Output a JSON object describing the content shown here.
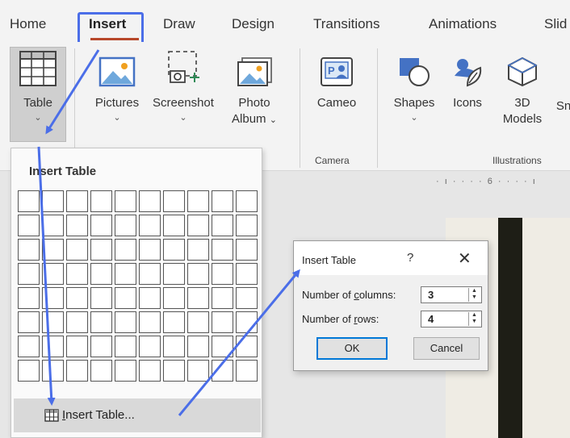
{
  "tabs": [
    {
      "label": "Home"
    },
    {
      "label": "Insert"
    },
    {
      "label": "Draw"
    },
    {
      "label": "Design"
    },
    {
      "label": "Transitions"
    },
    {
      "label": "Animations"
    },
    {
      "label": "Slid"
    }
  ],
  "ribbon": {
    "table": {
      "label": "Table",
      "icon": "table-icon"
    },
    "pictures": {
      "label": "Pictures",
      "icon": "pictures-icon"
    },
    "screenshot": {
      "label": "Screenshot",
      "icon": "screenshot-icon"
    },
    "photo_album": {
      "label1": "Photo",
      "label2": "Album",
      "icon": "photo-album-icon"
    },
    "cameo": {
      "label": "Cameo",
      "icon": "cameo-icon"
    },
    "shapes": {
      "label": "Shapes",
      "icon": "shapes-icon"
    },
    "icons": {
      "label": "Icons",
      "icon": "icons-icon"
    },
    "models": {
      "label1": "3D",
      "label2": "Models",
      "icon": "3d-models-icon"
    },
    "smartart": {
      "label": "Sn"
    },
    "group_camera": "Camera",
    "group_illustrations": "Illustrations"
  },
  "ruler": {
    "text": "· ı · · · · 6 · · · · ı"
  },
  "dropdown": {
    "title": "Insert Table",
    "grid_columns": 10,
    "grid_rows": 8,
    "insert_item": {
      "label_first": "I",
      "label_rest": "nsert Table...",
      "icon": "small-table-icon"
    }
  },
  "dialog": {
    "title": "Insert Table",
    "help": "?",
    "close": "✕",
    "columns_label_a": "Number of ",
    "columns_label_u": "c",
    "columns_label_b": "olumns:",
    "columns_value": "3",
    "rows_label_a": "Number of ",
    "rows_label_u": "r",
    "rows_label_b": "ows:",
    "rows_value": "4",
    "ok": "OK",
    "cancel": "Cancel"
  },
  "colors": {
    "accent_arrow": "#4b6ee8",
    "tab_underline": "#b7472a"
  }
}
